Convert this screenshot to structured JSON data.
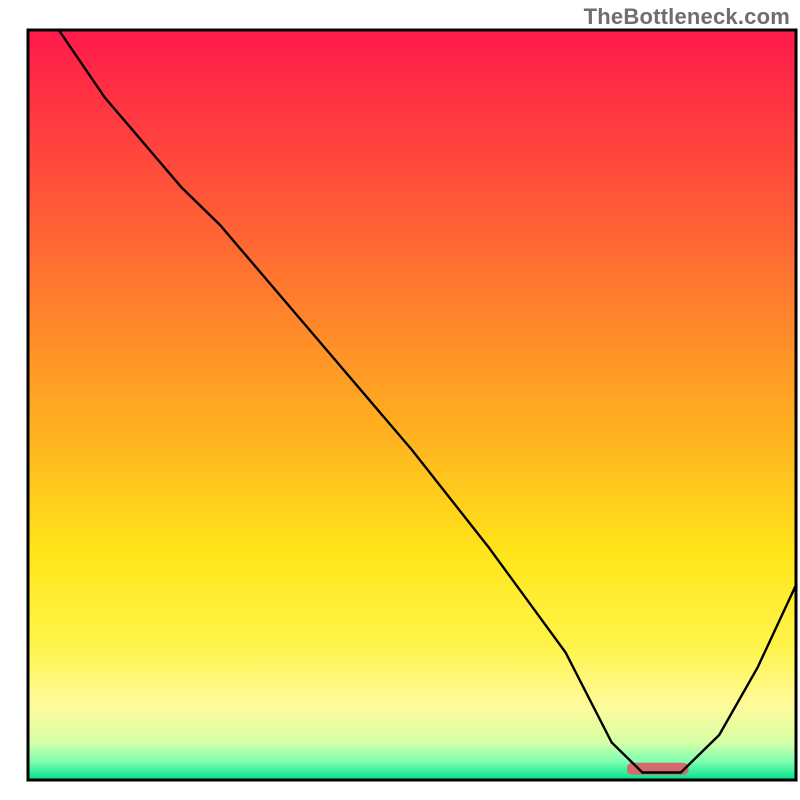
{
  "watermark": "TheBottleneck.com",
  "chart_data": {
    "type": "line",
    "title": "",
    "xlabel": "",
    "ylabel": "",
    "xlim": [
      0,
      100
    ],
    "ylim": [
      0,
      100
    ],
    "grid": false,
    "legend": false,
    "x": [
      4,
      10,
      20,
      25,
      30,
      40,
      50,
      60,
      70,
      76,
      80,
      85,
      90,
      95,
      100
    ],
    "values": [
      100,
      91,
      79,
      74,
      68,
      56,
      44,
      31,
      17,
      5,
      1,
      1,
      6,
      15,
      26
    ],
    "marker": {
      "x_start": 78,
      "x_end": 86,
      "y": 1.5
    },
    "gradient_stops": [
      {
        "offset": 0.0,
        "color": "#ff1a4b"
      },
      {
        "offset": 0.2,
        "color": "#ff4f3a"
      },
      {
        "offset": 0.4,
        "color": "#ff8a2a"
      },
      {
        "offset": 0.55,
        "color": "#ffb51f"
      },
      {
        "offset": 0.7,
        "color": "#ffe61a"
      },
      {
        "offset": 0.82,
        "color": "#fff44a"
      },
      {
        "offset": 0.9,
        "color": "#fffb9a"
      },
      {
        "offset": 0.95,
        "color": "#d6ffa6"
      },
      {
        "offset": 0.975,
        "color": "#7fffb0"
      },
      {
        "offset": 1.0,
        "color": "#00e28a"
      }
    ],
    "marker_color": "#d46a6a",
    "line_color": "#000000",
    "frame_color": "#000000"
  }
}
